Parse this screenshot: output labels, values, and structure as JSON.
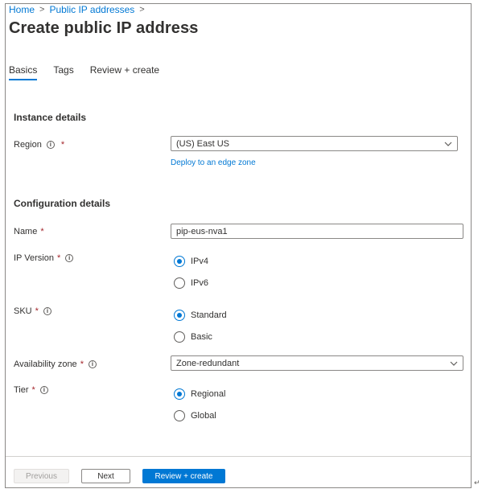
{
  "breadcrumb": [
    {
      "label": "Home"
    },
    {
      "label": "Public IP addresses"
    }
  ],
  "breadcrumb_separator": ">",
  "page_title": "Create public IP address",
  "more_label": "···",
  "tabs": [
    {
      "label": "Basics",
      "active": true
    },
    {
      "label": "Tags",
      "active": false
    },
    {
      "label": "Review + create",
      "active": false
    }
  ],
  "instance_details": {
    "title": "Instance details",
    "region": {
      "label": "Region",
      "value": "(US) East US",
      "edge_zone_link": "Deploy to an edge zone"
    }
  },
  "configuration_details": {
    "title": "Configuration details",
    "name": {
      "label": "Name",
      "value": "pip-eus-nva1"
    },
    "ip_version": {
      "label": "IP Version",
      "options": [
        {
          "label": "IPv4",
          "selected": true
        },
        {
          "label": "IPv6",
          "selected": false
        }
      ]
    },
    "sku": {
      "label": "SKU",
      "options": [
        {
          "label": "Standard",
          "selected": true
        },
        {
          "label": "Basic",
          "selected": false
        }
      ]
    },
    "availability_zone": {
      "label": "Availability zone",
      "value": "Zone-redundant"
    },
    "tier": {
      "label": "Tier",
      "options": [
        {
          "label": "Regional",
          "selected": true
        },
        {
          "label": "Global",
          "selected": false
        }
      ]
    }
  },
  "required_marker": "*",
  "info_glyph": "i",
  "footer": {
    "previous_label": "Previous",
    "next_label": "Next",
    "review_create_label": "Review + create"
  },
  "colors": {
    "accent": "#0078d4",
    "required": "#a4262c",
    "text": "#323130"
  },
  "icons": {
    "more": "more-icon",
    "info": "info-icon",
    "dropdown": "chevron-down-icon"
  },
  "trailing_mark": "↵"
}
